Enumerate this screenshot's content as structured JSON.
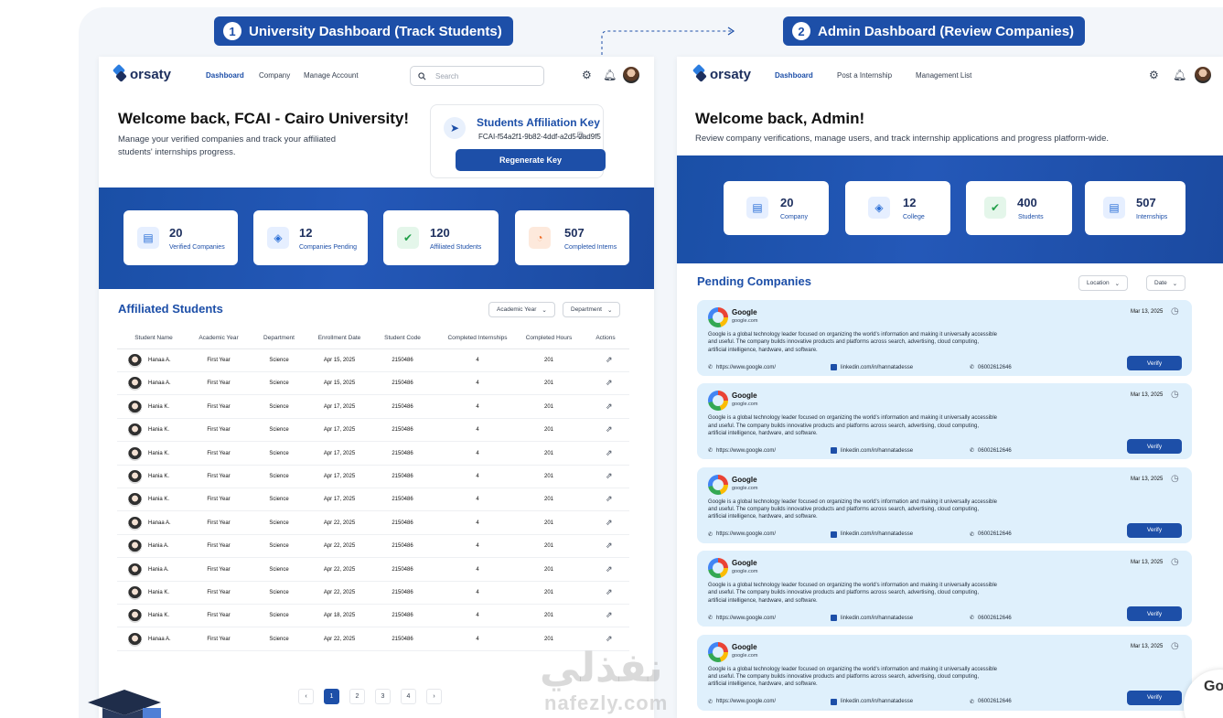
{
  "sections": [
    {
      "num": "1",
      "label": "University Dashboard (Track Students)"
    },
    {
      "num": "2",
      "label": "Admin Dashboard (Review Companies)"
    }
  ],
  "brand": "orsaty",
  "uni": {
    "nav": [
      "Dashboard",
      "Company",
      "Manage Account"
    ],
    "search_placeholder": "Search",
    "welcome_title": "Welcome back, FCAI - Cairo University!",
    "welcome_sub_1": "Manage your verified companies and track your affiliated",
    "welcome_sub_2": "students' internships progress.",
    "key_title": "Students Affiliation Key",
    "key_value": "FCAI-f54a2f1-9b82-4ddf-a2d5-2ad9f5",
    "key_button": "Regenerate Key",
    "stats": [
      {
        "value": "20",
        "label": "Verified Companies",
        "icon": "document-icon",
        "color": "#2b6fd6",
        "bg": "#e6efff"
      },
      {
        "value": "12",
        "label": "Companies Pending",
        "icon": "layers-icon",
        "color": "#2b6fd6",
        "bg": "#e6efff"
      },
      {
        "value": "120",
        "label": "Affiliated Students",
        "icon": "user-check-icon",
        "color": "#22a04a",
        "bg": "#e4f6ea"
      },
      {
        "value": "507",
        "label": "Completed Interns",
        "icon": "pie-chart-icon",
        "color": "#f0702b",
        "bg": "#fde9dc"
      }
    ],
    "table_title": "Affiliated Students",
    "filters": [
      "Academic Year",
      "Department"
    ],
    "columns": [
      "Student Name",
      "Academic Year",
      "Department",
      "Enrollment Date",
      "Student Code",
      "Completed Internships",
      "Completed Hours",
      "Actions"
    ],
    "rows": [
      [
        "Hanaa A.",
        "First Year",
        "Science",
        "Apr 15, 2025",
        "2150486",
        "4",
        "201"
      ],
      [
        "Hanaa A.",
        "First Year",
        "Science",
        "Apr 15, 2025",
        "2150486",
        "4",
        "201"
      ],
      [
        "Hania K.",
        "First Year",
        "Science",
        "Apr 17, 2025",
        "2150486",
        "4",
        "201"
      ],
      [
        "Hania K.",
        "First Year",
        "Science",
        "Apr 17, 2025",
        "2150486",
        "4",
        "201"
      ],
      [
        "Hania K.",
        "First Year",
        "Science",
        "Apr 17, 2025",
        "2150486",
        "4",
        "201"
      ],
      [
        "Hania K.",
        "First Year",
        "Science",
        "Apr 17, 2025",
        "2150486",
        "4",
        "201"
      ],
      [
        "Hania K.",
        "First Year",
        "Science",
        "Apr 17, 2025",
        "2150486",
        "4",
        "201"
      ],
      [
        "Hanaa A.",
        "First Year",
        "Science",
        "Apr 22, 2025",
        "2150486",
        "4",
        "201"
      ],
      [
        "Hania A.",
        "First Year",
        "Science",
        "Apr 22, 2025",
        "2150486",
        "4",
        "201"
      ],
      [
        "Hania A.",
        "First Year",
        "Science",
        "Apr 22, 2025",
        "2150486",
        "4",
        "201"
      ],
      [
        "Hania K.",
        "First Year",
        "Science",
        "Apr 22, 2025",
        "2150486",
        "4",
        "201"
      ],
      [
        "Hania K.",
        "First Year",
        "Science",
        "Apr 18, 2025",
        "2150486",
        "4",
        "201"
      ],
      [
        "Hanaa A.",
        "First Year",
        "Science",
        "Apr 22, 2025",
        "2150486",
        "4",
        "201"
      ]
    ],
    "pages": [
      "‹",
      "1",
      "2",
      "3",
      "4",
      "›"
    ],
    "active_page": "1"
  },
  "admin": {
    "nav": [
      "Dashboard",
      "Post a Internship",
      "Management List"
    ],
    "welcome_title": "Welcome back, Admin!",
    "welcome_sub": "Review company verifications, manage users, and track internship applications and progress platform-wide.",
    "stats": [
      {
        "value": "20",
        "label": "Company",
        "icon": "document-icon",
        "color": "#2b6fd6",
        "bg": "#e6efff"
      },
      {
        "value": "12",
        "label": "College",
        "icon": "layers-icon",
        "color": "#2b6fd6",
        "bg": "#e6efff"
      },
      {
        "value": "400",
        "label": "Students",
        "icon": "user-check-icon",
        "color": "#22a04a",
        "bg": "#e4f6ea"
      },
      {
        "value": "507",
        "label": "Internships",
        "icon": "document-icon",
        "color": "#2b6fd6",
        "bg": "#e6efff"
      }
    ],
    "section_title": "Pending Companies",
    "filters": [
      "Location",
      "Date"
    ],
    "companies": [
      {
        "name": "Google",
        "domain": "google.com",
        "date": "Mar 13, 2025",
        "website": "https://www.google.com/",
        "linkedin": "linkedin.com/in/hannatadesse",
        "phone": "06002612646",
        "button": "Verify"
      },
      {
        "name": "Google",
        "domain": "google.com",
        "date": "Mar 13, 2025",
        "website": "https://www.google.com/",
        "linkedin": "linkedin.com/in/hannatadesse",
        "phone": "06002612646",
        "button": "Verify"
      },
      {
        "name": "Google",
        "domain": "google.com",
        "date": "Mar 13, 2025",
        "website": "https://www.google.com/",
        "linkedin": "linkedin.com/in/hannatadesse",
        "phone": "06002612646",
        "button": "Verify"
      },
      {
        "name": "Google",
        "domain": "google.com",
        "date": "Mar 13, 2025",
        "website": "https://www.google.com/",
        "linkedin": "linkedin.com/in/hannatadesse",
        "phone": "06002612646",
        "button": "Verify"
      },
      {
        "name": "Google",
        "domain": "google.com",
        "date": "Mar 13, 2025",
        "website": "https://www.google.com/",
        "linkedin": "linkedin.com/in/hannatadesse",
        "phone": "06002612646",
        "button": "Verify"
      }
    ],
    "company_desc_1": "Google is a global technology leader focused on organizing the world's information and making it universally accessible",
    "company_desc_2": "and useful. The company builds innovative products and platforms across search, advertising, cloud computing,",
    "company_desc_3": "artificial intelligence, hardware, and software."
  },
  "watermark_ar": "نفذلي",
  "watermark_en": "nafezly.com",
  "corner_text": "Go"
}
